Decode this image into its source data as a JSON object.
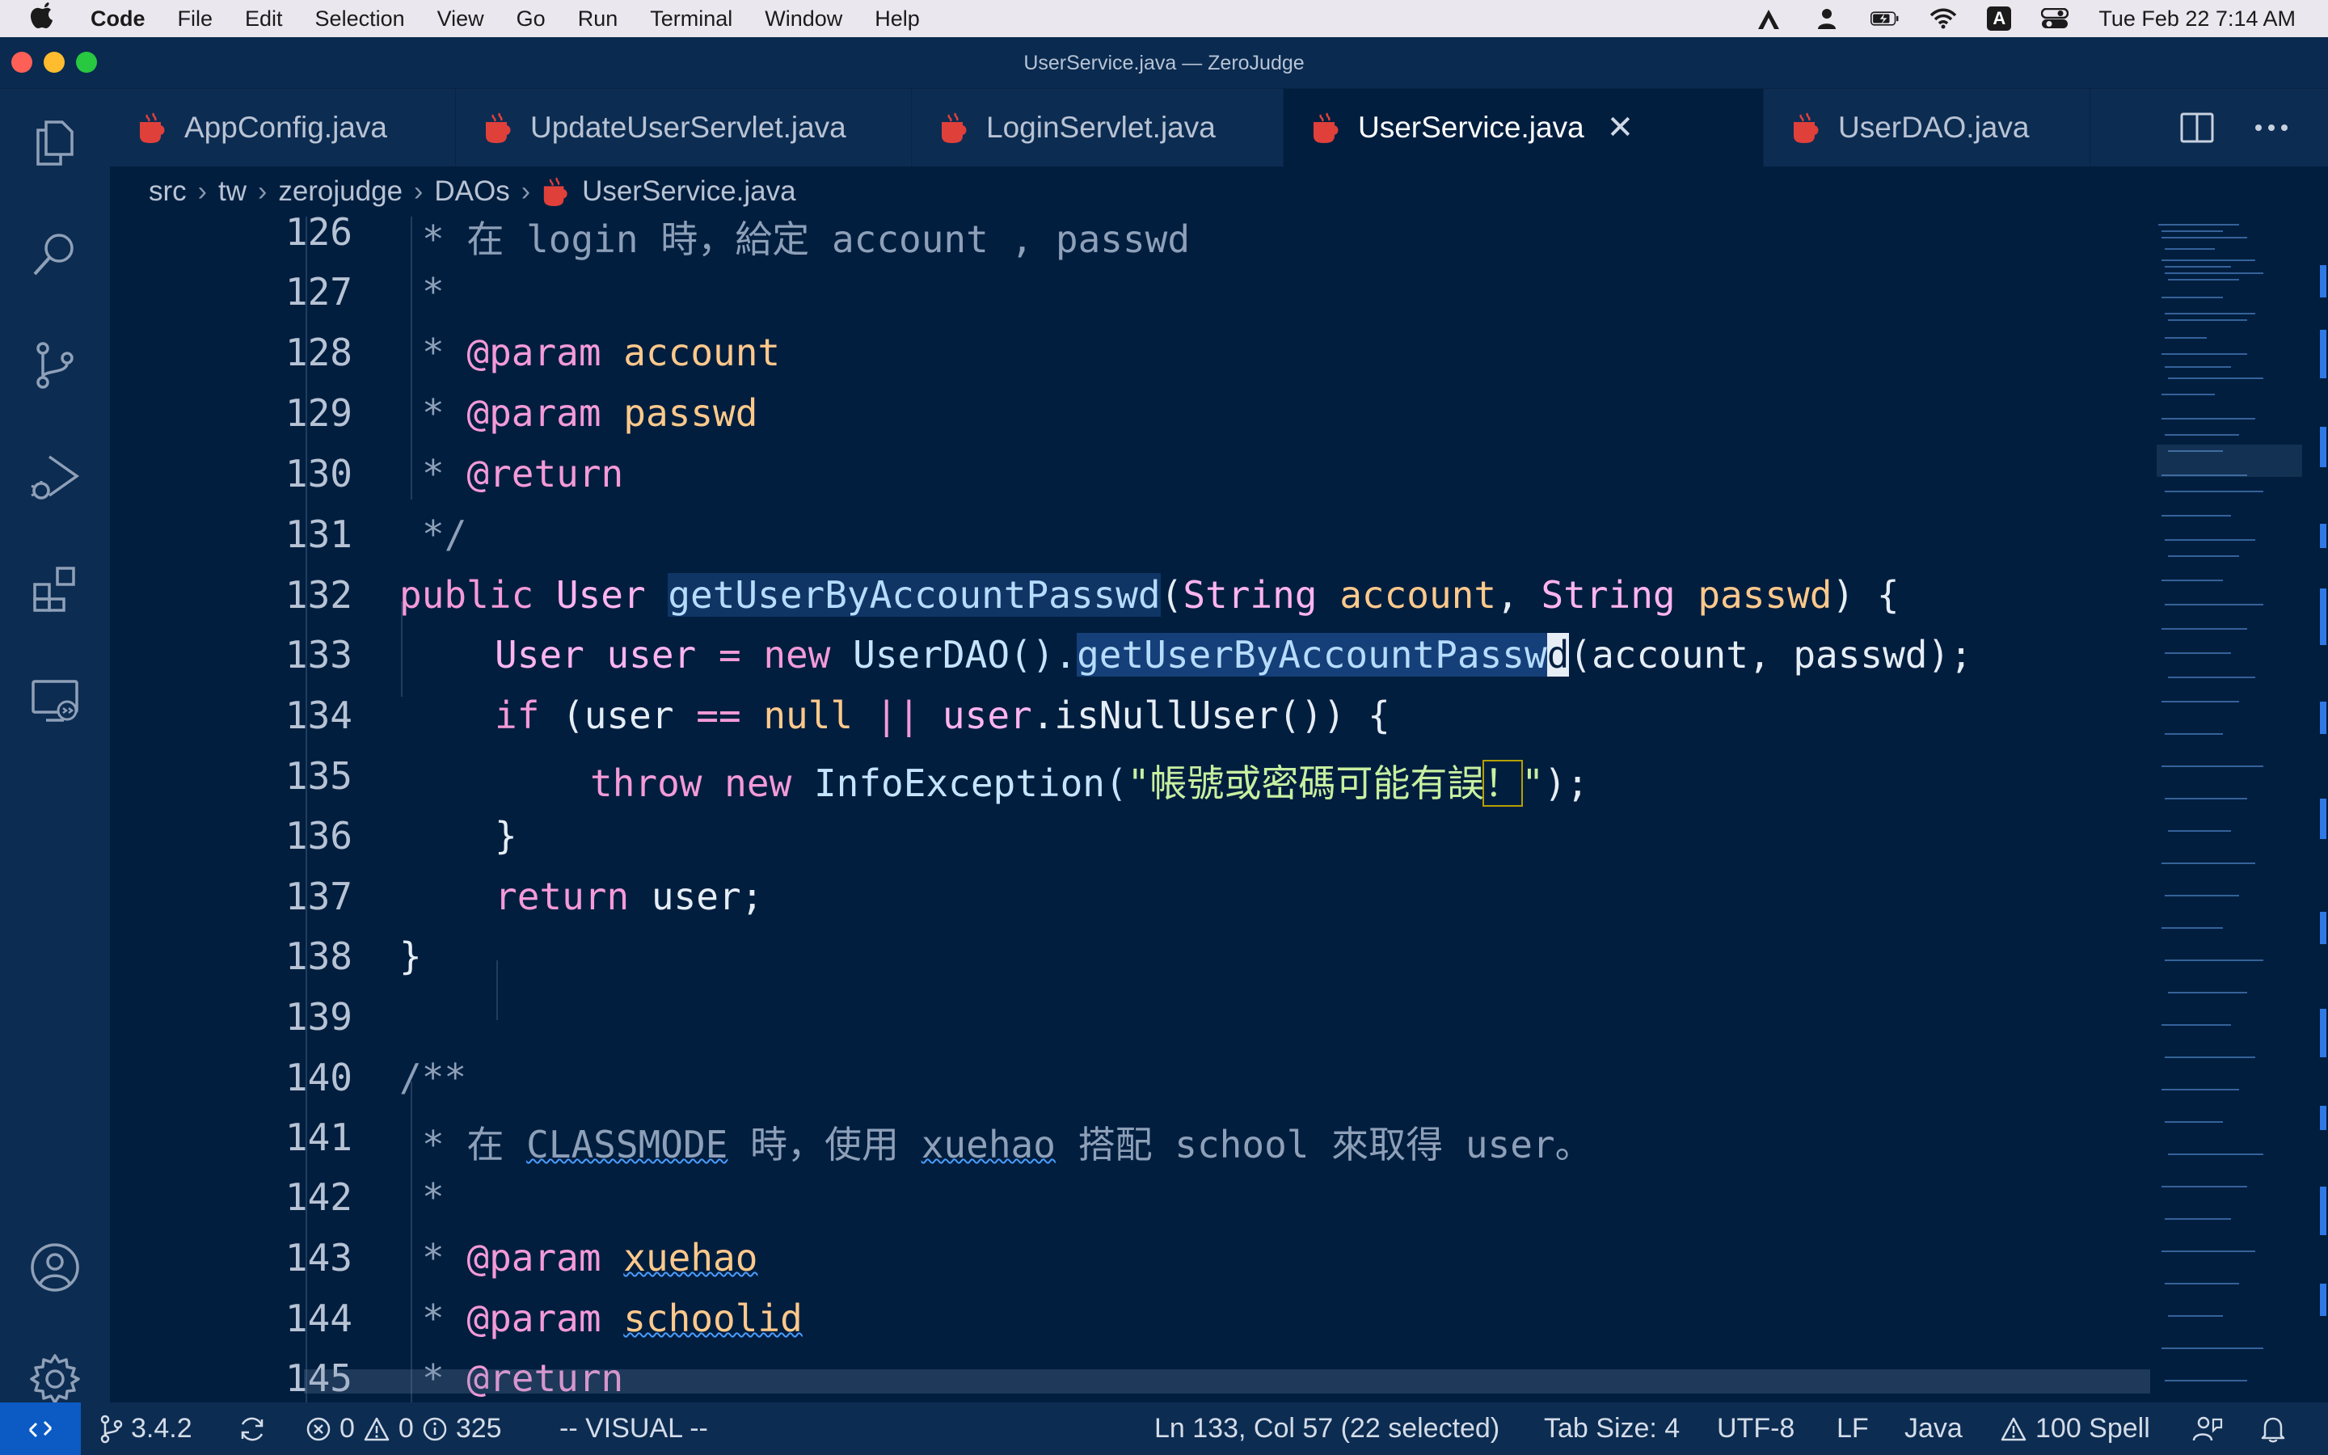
{
  "menubar": {
    "app": "Code",
    "items": [
      "File",
      "Edit",
      "Selection",
      "View",
      "Go",
      "Run",
      "Terminal",
      "Window",
      "Help"
    ],
    "input_badge": "A",
    "clock": "Tue Feb 22  7:14 AM"
  },
  "window": {
    "title": "UserService.java — ZeroJudge"
  },
  "tabs": [
    {
      "label": "AppConfig.java"
    },
    {
      "label": "UpdateUserServlet.java"
    },
    {
      "label": "LoginServlet.java"
    },
    {
      "label": "UserService.java",
      "active": true
    },
    {
      "label": "UserDAO.java"
    }
  ],
  "breadcrumb": {
    "parts": [
      "src",
      "tw",
      "zerojudge",
      "DAOs",
      "UserService.java"
    ]
  },
  "editor": {
    "lines": {
      "l126": "126",
      "l127": "127",
      "l128": "128",
      "l129": "129",
      "l130": "130",
      "l131": "131",
      "l132": "132",
      "l133": "133",
      "l134": "134",
      "l135": "135",
      "l136": "136",
      "l137": "137",
      "l138": "138",
      "l139": "139",
      "l140": "140",
      "l141": "141",
      "l142": "142",
      "l143": "143",
      "l144": "144",
      "l145": "145"
    },
    "code": {
      "c126": "* 在 login 時，給定 account , passwd",
      "c127": "*",
      "c128_star": "* ",
      "c128_tag": "@param",
      "c128_name": " account",
      "c129_star": "* ",
      "c129_tag": "@param",
      "c129_name": " passwd",
      "c130_star": "* ",
      "c130_tag": "@return",
      "c131": "*/",
      "c132_kw": "public",
      "c132_type": " User ",
      "c132_fn": "getUserByAccountPasswd",
      "c132_p1": "(",
      "c132_t1": "String",
      "c132_a1": " account",
      "c132_c": ", ",
      "c132_t2": "String",
      "c132_a2": " passwd",
      "c132_end": ") {",
      "c133_type": "User",
      "c133_var": " user",
      "c133_eq": " = ",
      "c133_new": "new",
      "c133_cls": " UserDAO().",
      "c133_fnsel": "getUserByAccountPassw",
      "c133_cur": "d",
      "c133_rest": "(account, passwd);",
      "c134_if": "if",
      "c134_a": " (user ",
      "c134_eq": "==",
      "c134_null": " null",
      "c134_or": " ||",
      "c134_user": " user",
      "c134_rest": ".isNullUser()) {",
      "c135_throw": "throw",
      "c135_new": " new",
      "c135_cls": " InfoException(",
      "c135_str": "\"帳號或密碼可能有誤",
      "c135_bang": "！",
      "c135_strend": "\"",
      "c135_end": ");",
      "c136": "}",
      "c137_ret": "return",
      "c137_rest": " user;",
      "c138": "}",
      "c140": "/**",
      "c141_a": "* 在 ",
      "c141_b": "CLASSMODE",
      "c141_c": " 時，使用 ",
      "c141_d": "xuehao",
      "c141_e": " 搭配 school 來取得 user。",
      "c142": "*",
      "c143_star": "* ",
      "c143_tag": "@param",
      "c143_name": "xuehao",
      "c144_star": "* ",
      "c144_tag": "@param",
      "c144_name": "schoolid",
      "c145_star": "* ",
      "c145_tag": "@return"
    }
  },
  "statusbar": {
    "version": "3.4.2",
    "errors": "0",
    "warnings": "0",
    "info": "325",
    "mode": "-- VISUAL --",
    "position": "Ln 133, Col 57 (22 selected)",
    "tab_size": "Tab Size: 4",
    "encoding": "UTF-8",
    "eol": "LF",
    "language": "Java",
    "spell": "100 Spell"
  },
  "colors": {
    "editor_bg": "#011e3f",
    "sidebar_bg": "#0c2c52",
    "accent": "#0c5bc4",
    "file_icon": "#e0403a"
  },
  "icons": [
    "apple-icon",
    "files-icon",
    "search-icon",
    "source-control-icon",
    "run-debug-icon",
    "extensions-icon",
    "remote-explorer-icon",
    "account-icon",
    "settings-gear-icon",
    "split-editor-icon",
    "more-actions-icon",
    "java-file-icon",
    "close-icon",
    "git-branch-icon",
    "sync-icon",
    "error-icon",
    "warning-icon",
    "info-icon",
    "feedback-icon",
    "bell-icon"
  ]
}
